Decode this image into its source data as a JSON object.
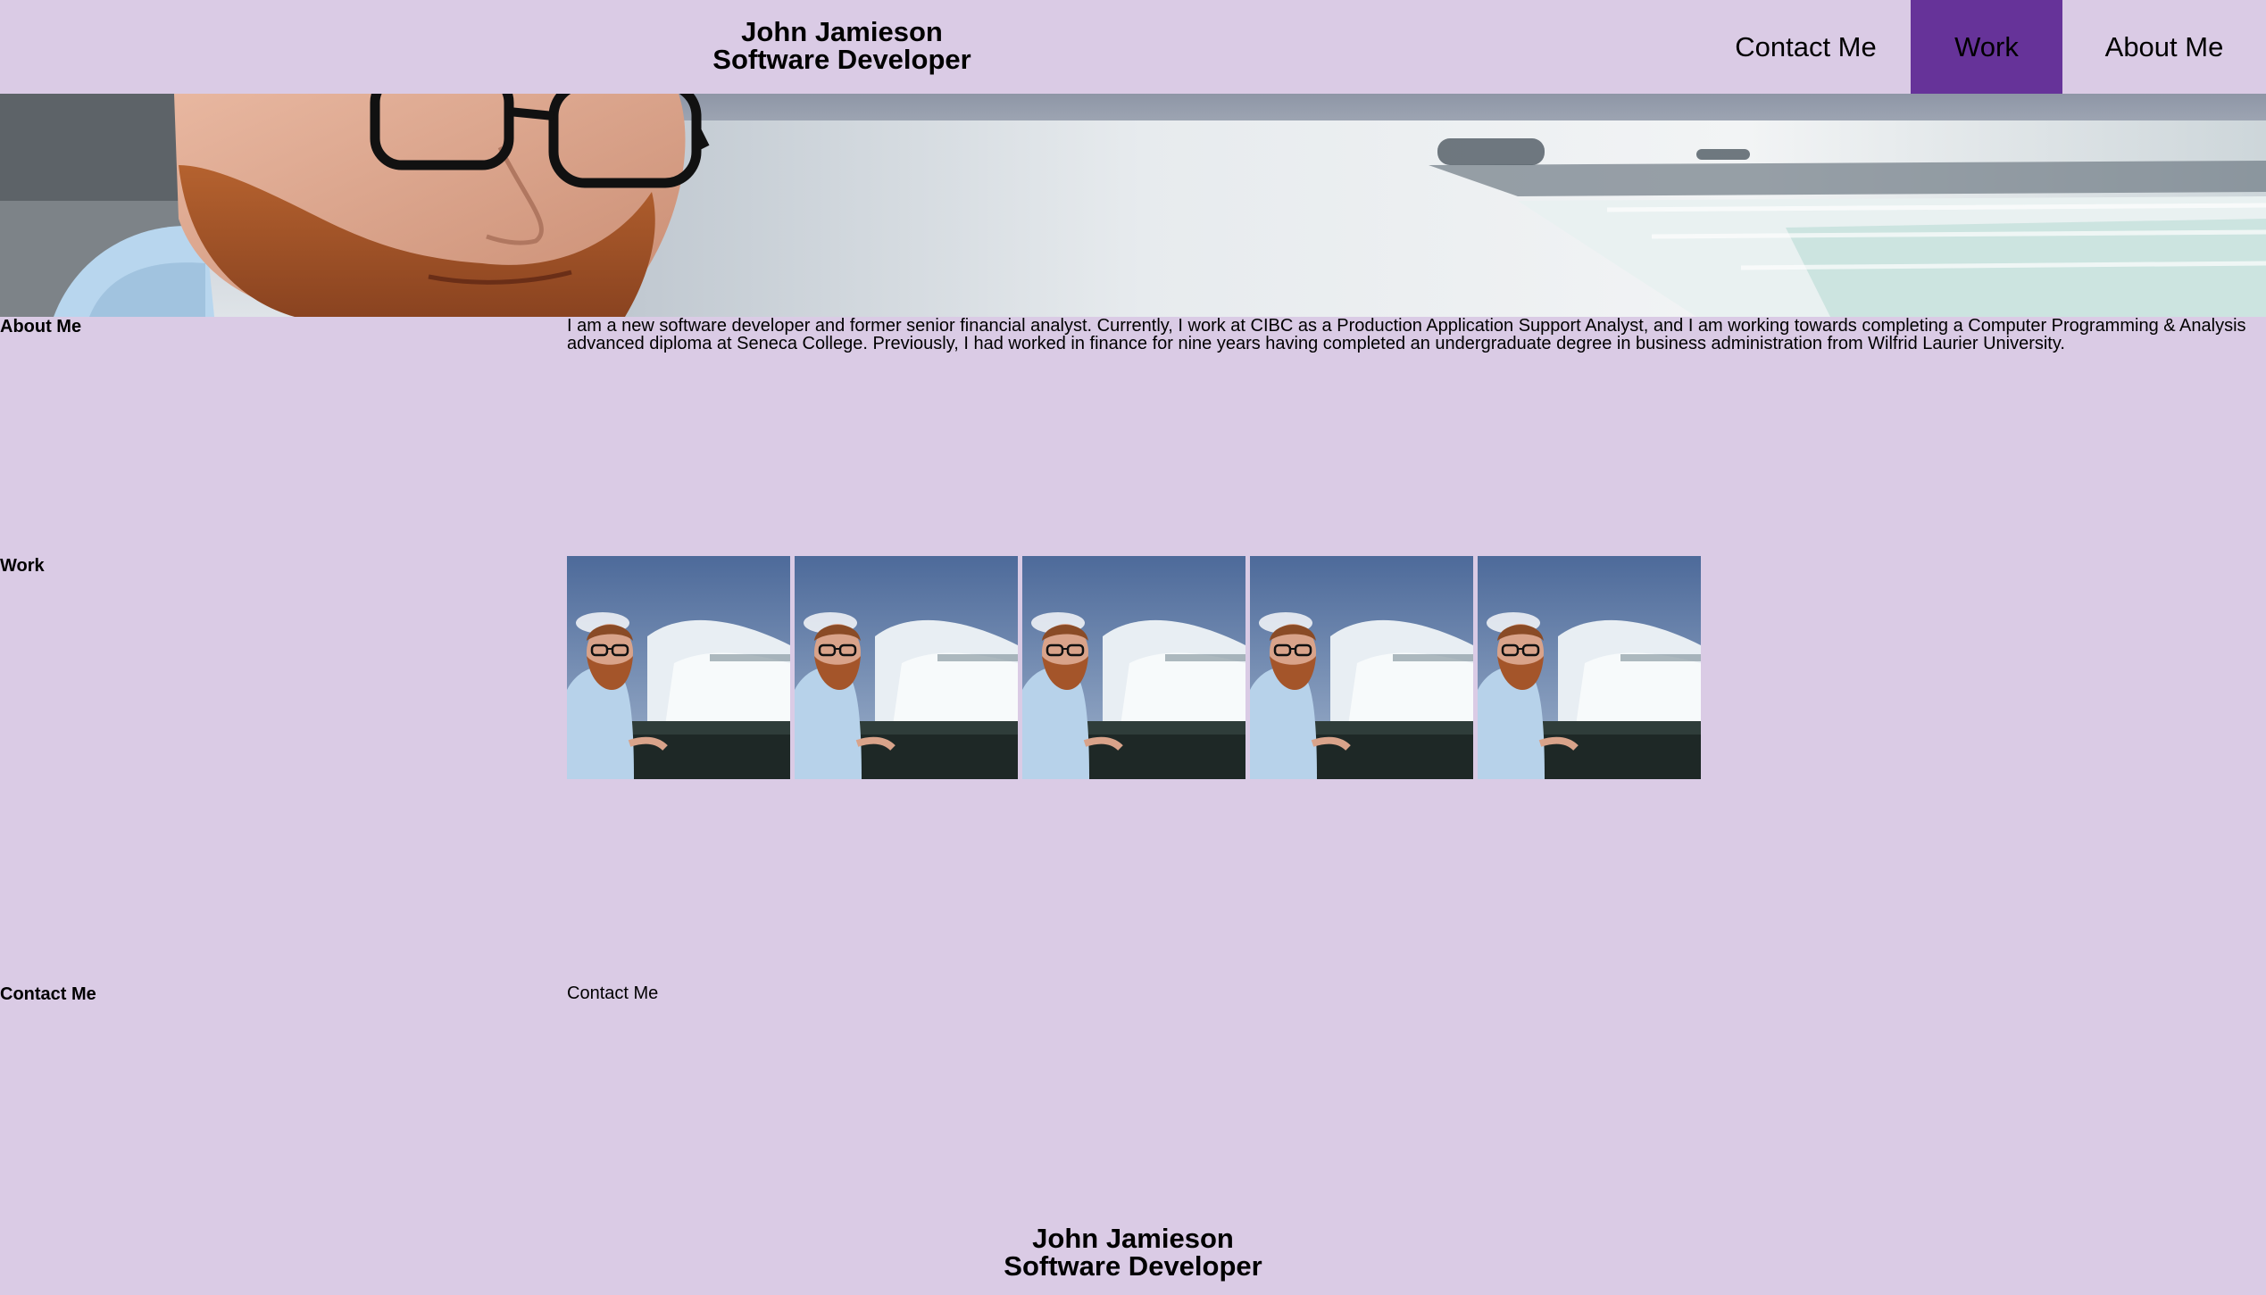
{
  "header": {
    "name": "John Jamieson",
    "role": "Software Developer"
  },
  "nav": {
    "items": [
      {
        "label": "Contact Me"
      },
      {
        "label": "Work",
        "active": true
      },
      {
        "label": "About Me"
      }
    ],
    "active_color": "#663399"
  },
  "hero": {
    "image": "portrait-at-waterfall-banner"
  },
  "sections": {
    "about": {
      "heading": "About Me",
      "text": "I am a new software developer and former senior financial analyst. Currently, I work at CIBC as a Production Application Support Analyst, and I am working towards completing a Computer Programming & Analysis advanced diploma at Seneca College. Previously, I had worked in finance for nine years having completed an undergraduate degree in business administration from Wilfrid Laurier University."
    },
    "work": {
      "heading": "Work",
      "thumbnails": [
        {
          "image": "portrait-at-waterfall"
        },
        {
          "image": "portrait-at-waterfall"
        },
        {
          "image": "portrait-at-waterfall"
        },
        {
          "image": "portrait-at-waterfall"
        },
        {
          "image": "portrait-at-waterfall"
        }
      ]
    },
    "contact": {
      "heading": "Contact Me",
      "text": "Contact Me"
    }
  },
  "footer": {
    "name": "John Jamieson",
    "role": "Software Developer"
  },
  "colors": {
    "background": "#dacbe5",
    "nav_active": "#663399"
  }
}
